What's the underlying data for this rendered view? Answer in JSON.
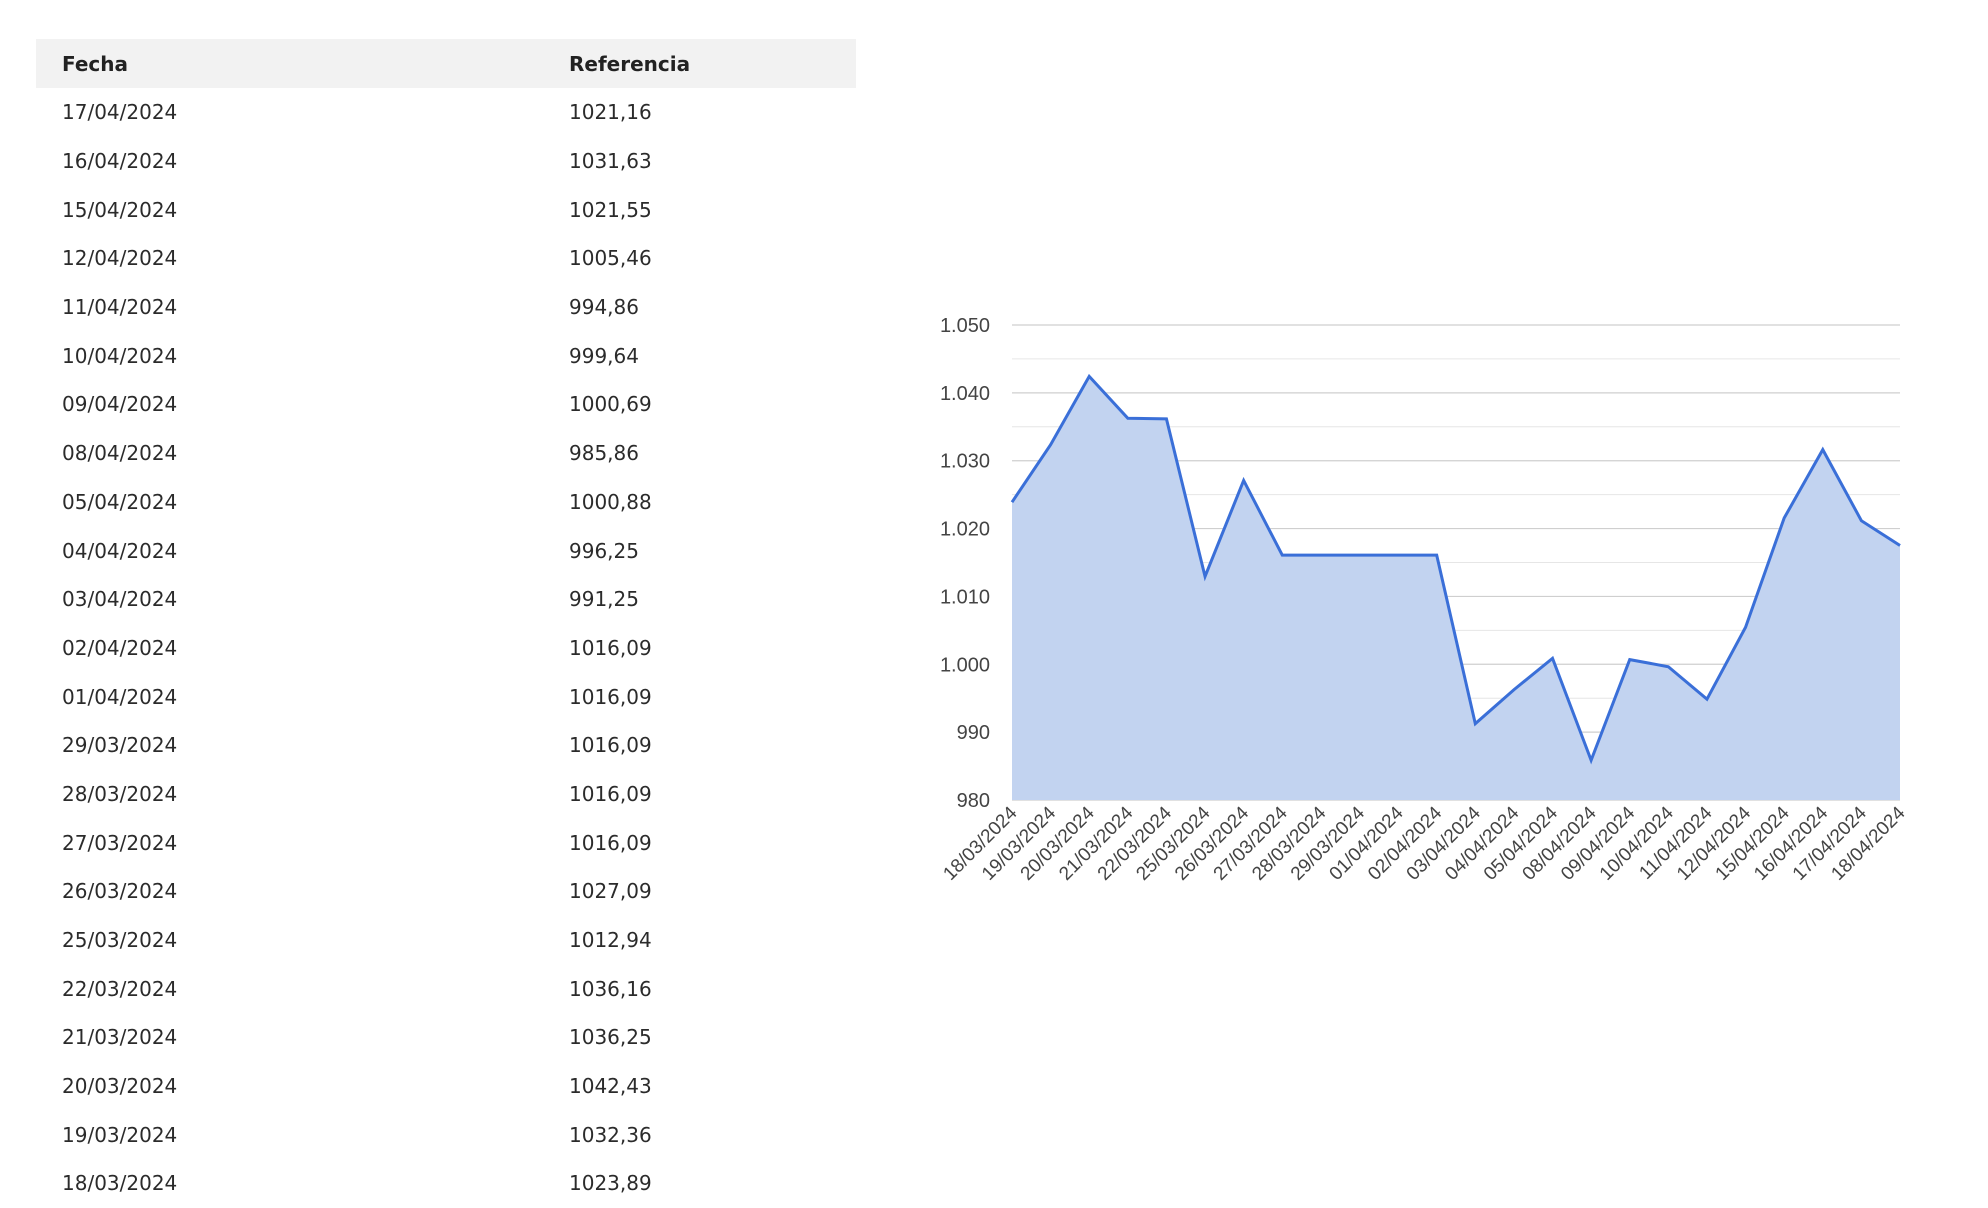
{
  "table": {
    "headers": {
      "fecha": "Fecha",
      "referencia": "Referencia"
    },
    "rows": [
      {
        "fecha": "17/04/2024",
        "referencia": "1021,16"
      },
      {
        "fecha": "16/04/2024",
        "referencia": "1031,63"
      },
      {
        "fecha": "15/04/2024",
        "referencia": "1021,55"
      },
      {
        "fecha": "12/04/2024",
        "referencia": "1005,46"
      },
      {
        "fecha": "11/04/2024",
        "referencia": "994,86"
      },
      {
        "fecha": "10/04/2024",
        "referencia": "999,64"
      },
      {
        "fecha": "09/04/2024",
        "referencia": "1000,69"
      },
      {
        "fecha": "08/04/2024",
        "referencia": "985,86"
      },
      {
        "fecha": "05/04/2024",
        "referencia": "1000,88"
      },
      {
        "fecha": "04/04/2024",
        "referencia": "996,25"
      },
      {
        "fecha": "03/04/2024",
        "referencia": "991,25"
      },
      {
        "fecha": "02/04/2024",
        "referencia": "1016,09"
      },
      {
        "fecha": "01/04/2024",
        "referencia": "1016,09"
      },
      {
        "fecha": "29/03/2024",
        "referencia": "1016,09"
      },
      {
        "fecha": "28/03/2024",
        "referencia": "1016,09"
      },
      {
        "fecha": "27/03/2024",
        "referencia": "1016,09"
      },
      {
        "fecha": "26/03/2024",
        "referencia": "1027,09"
      },
      {
        "fecha": "25/03/2024",
        "referencia": "1012,94"
      },
      {
        "fecha": "22/03/2024",
        "referencia": "1036,16"
      },
      {
        "fecha": "21/03/2024",
        "referencia": "1036,25"
      },
      {
        "fecha": "20/03/2024",
        "referencia": "1042,43"
      },
      {
        "fecha": "19/03/2024",
        "referencia": "1032,36"
      },
      {
        "fecha": "18/03/2024",
        "referencia": "1023,89"
      }
    ]
  },
  "chart_data": {
    "type": "area",
    "title": "",
    "xlabel": "",
    "ylabel": "",
    "x": [
      "18/03/2024",
      "19/03/2024",
      "20/03/2024",
      "21/03/2024",
      "22/03/2024",
      "25/03/2024",
      "26/03/2024",
      "27/03/2024",
      "28/03/2024",
      "29/03/2024",
      "01/04/2024",
      "02/04/2024",
      "03/04/2024",
      "04/04/2024",
      "05/04/2024",
      "08/04/2024",
      "09/04/2024",
      "10/04/2024",
      "11/04/2024",
      "12/04/2024",
      "15/04/2024",
      "16/04/2024",
      "17/04/2024",
      "18/04/2024"
    ],
    "series": [
      {
        "values": [
          1023.89,
          1032.36,
          1042.43,
          1036.25,
          1036.16,
          1012.94,
          1027.09,
          1016.09,
          1016.09,
          1016.09,
          1016.09,
          1016.09,
          991.25,
          996.25,
          1000.88,
          985.86,
          1000.69,
          999.64,
          994.86,
          1005.46,
          1021.55,
          1031.63,
          1021.16,
          1017.5
        ]
      }
    ],
    "ylim": [
      980,
      1050
    ],
    "y_ticks": [
      980,
      990,
      1000,
      1010,
      1020,
      1030,
      1040,
      1050
    ],
    "y_tick_labels": [
      "980",
      "990",
      "1.000",
      "1.010",
      "1.020",
      "1.030",
      "1.040",
      "1.050"
    ],
    "grid": true,
    "legend": "none",
    "colors": {
      "line": "#3a6fd8",
      "fill": "#c2d3f0",
      "grid_major": "#cfcfcf",
      "grid_minor": "#e6e6e6",
      "axis_text": "#444444"
    }
  }
}
